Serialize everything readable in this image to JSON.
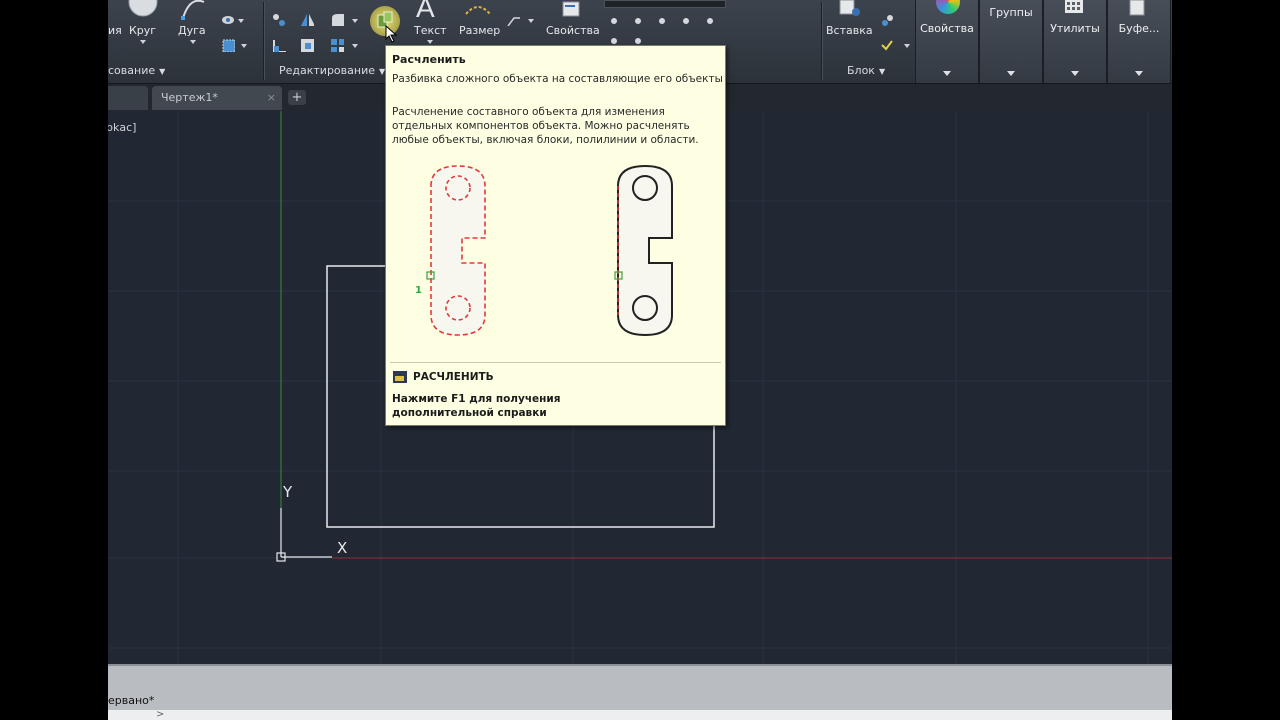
{
  "ribbon": {
    "draw": {
      "circle_label": "Круг",
      "arc_label": "Дуга",
      "truncated_left_label": "ия",
      "panel_label": "сование"
    },
    "modify": {
      "panel_label": "Редактирование"
    },
    "annotation": {
      "text_label": "Текст",
      "dimension_label": "Размер"
    },
    "layers": {
      "properties_label": "Свойства"
    },
    "block": {
      "insert_label": "Вставка",
      "panel_label": "Блок"
    },
    "properties_tab": {
      "label": "Свойства"
    },
    "groups_tab": {
      "label": "Группы"
    },
    "utilities_tab": {
      "label": "Утилиты"
    },
    "clipboard_tab": {
      "label": "Буфе..."
    }
  },
  "tabs": {
    "drawing_tab_label": "Чертеж1*",
    "close_glyph": "×",
    "new_tab_glyph": "+"
  },
  "viewport": {
    "controls_text": "рkас]",
    "ucs_y_label": "Y",
    "ucs_x_label": "X"
  },
  "tooltip": {
    "title": "Расчленить",
    "summary": "Разбивка сложного объекта на составляющие его объекты",
    "description": "Расчленение составного объекта для изменения отдельных компонентов объекта. Можно расчленять любые объекты, включая блоки, полилинии и области.",
    "illustration_marker": "1",
    "command_name": "РАСЧЛЕНИТЬ",
    "help_line1": "Нажмите F1 для получения",
    "help_line2": "дополнительной справки"
  },
  "command_line": {
    "history_text": "ервано*"
  },
  "colors": {
    "canvas_bg": "#212834",
    "tooltip_bg": "#fefee3",
    "dash_red": "#e03a3a",
    "grip_green": "#3aa23a",
    "ucs_y_axis": "#3d8a3d",
    "ucs_x_axis": "#8a2e2e"
  }
}
